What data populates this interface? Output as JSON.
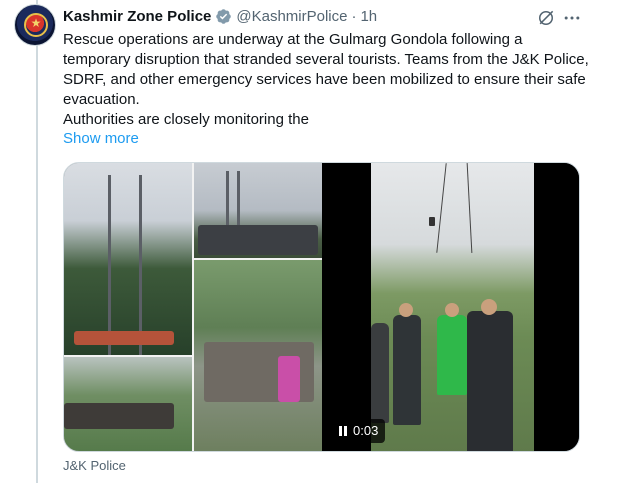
{
  "tweet": {
    "author_name": "Kashmir Zone Police",
    "handle": "@KashmirPolice",
    "separator": "·",
    "time": "1h",
    "text_lines": [
      "Rescue operations are underway at the Gulmarg Gondola following a temporary disruption that stranded several tourists. Teams from the J&K Police, SDRF, and other emergency services have been mobilized to ensure their safe evacuation.",
      "Authorities are closely monitoring the"
    ],
    "show_more_label": "Show more",
    "video_time": "0:03",
    "source_label": "J&K Police"
  },
  "icons": {
    "verified": "verified-badge-icon",
    "grok": "grok-icon",
    "more": "more-options-icon",
    "pause": "pause-icon"
  },
  "colors": {
    "link": "#1d9bf0",
    "muted": "#536471",
    "verified": "#829aab"
  }
}
